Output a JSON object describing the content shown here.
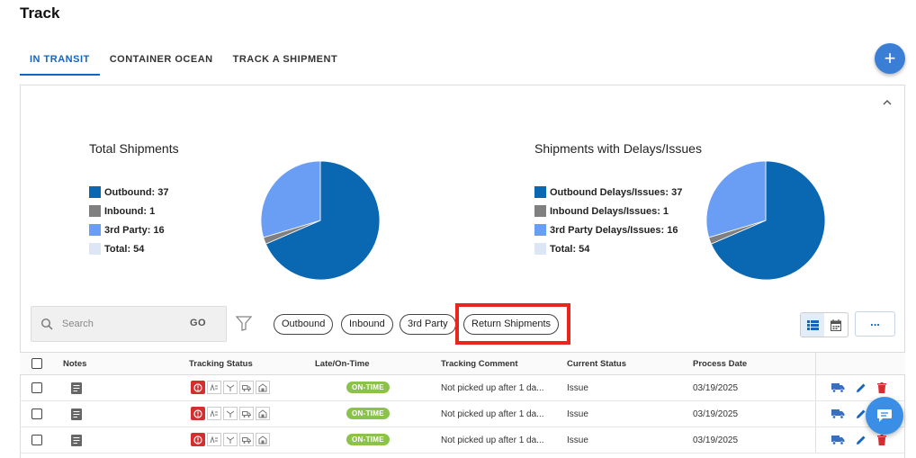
{
  "page": {
    "title": "Track"
  },
  "tabs": [
    {
      "label": "IN TRANSIT",
      "active": true
    },
    {
      "label": "CONTAINER OCEAN",
      "active": false
    },
    {
      "label": "TRACK A SHIPMENT",
      "active": false
    }
  ],
  "fab": {
    "icon": "plus-icon",
    "label": "+"
  },
  "charts": {
    "colors": {
      "outbound": "#0a67b2",
      "inbound": "#808080",
      "third_party": "#6a9ef5",
      "total": "#dde6f5"
    }
  },
  "chart_data": [
    {
      "type": "pie",
      "title": "Total Shipments",
      "legend": [
        "Outbound: 37",
        "Inbound: 1",
        "3rd Party: 16",
        "Total: 54"
      ],
      "categories": [
        "Outbound",
        "Inbound",
        "3rd Party"
      ],
      "values": [
        37,
        1,
        16
      ],
      "total": 54
    },
    {
      "type": "pie",
      "title": "Shipments with Delays/Issues",
      "legend": [
        "Outbound Delays/Issues: 37",
        "Inbound Delays/Issues: 1",
        "3rd Party Delays/Issues: 16",
        "Total: 54"
      ],
      "categories": [
        "Outbound Delays/Issues",
        "Inbound Delays/Issues",
        "3rd Party Delays/Issues"
      ],
      "values": [
        37,
        1,
        16
      ],
      "total": 54
    }
  ],
  "search": {
    "placeholder": "Search",
    "go_label": "GO"
  },
  "filters": {
    "chips": [
      "Outbound",
      "Inbound",
      "3rd Party",
      "Return Shipments"
    ],
    "highlighted": "Return Shipments",
    "highlight_color": "#e8261e"
  },
  "toolbar": {
    "more_label": "..."
  },
  "table": {
    "columns": [
      "Notes",
      "Tracking Status",
      "Late/On-Time",
      "Tracking Comment",
      "Current Status",
      "Process Date"
    ],
    "rows": [
      {
        "late": "ON-TIME",
        "comment": "Not picked up after 1 da...",
        "status": "Issue",
        "date": "03/19/2025"
      },
      {
        "late": "ON-TIME",
        "comment": "Not picked up after 1 da...",
        "status": "Issue",
        "date": "03/19/2025"
      },
      {
        "late": "ON-TIME",
        "comment": "Not picked up after 1 da...",
        "status": "Issue",
        "date": "03/19/2025"
      }
    ]
  }
}
